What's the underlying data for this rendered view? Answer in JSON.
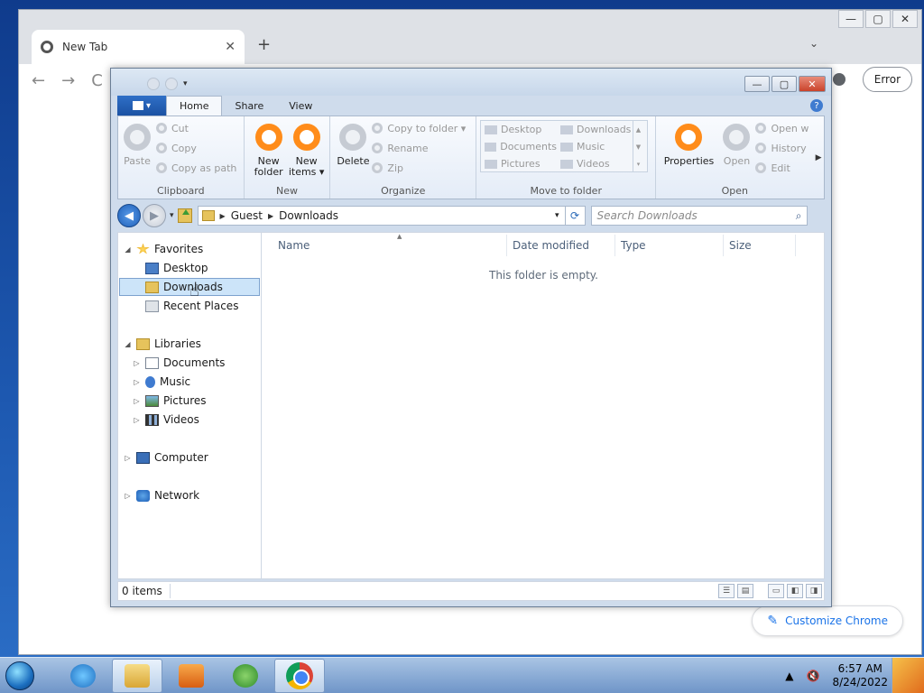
{
  "chrome": {
    "tab_title": "New Tab",
    "tab_close": "✕",
    "new_tab": "+",
    "tab_search": "⌄",
    "back": "←",
    "forward": "→",
    "reload": "C",
    "error_label": "Error",
    "customize_label": "Customize Chrome",
    "window_controls": {
      "minimize": "—",
      "maximize": "▢",
      "close": "✕"
    }
  },
  "explorer": {
    "qat_arrow": "▾",
    "window_controls": {
      "minimize": "—",
      "maximize": "▢",
      "close": "✕"
    },
    "file_menu_arrow": "▾",
    "tabs": [
      "Home",
      "Share",
      "View"
    ],
    "help": "?",
    "ribbon": {
      "clipboard": {
        "label": "Clipboard",
        "paste": "Paste",
        "cut": "Cut",
        "copy": "Copy",
        "copy_as_path": "Copy as path"
      },
      "new": {
        "label": "New",
        "new_folder": "New folder",
        "new_items": "New items ▾"
      },
      "organize": {
        "label": "Organize",
        "delete": "Delete",
        "copy_to_folder": "Copy to folder ▾",
        "rename": "Rename",
        "zip": "Zip"
      },
      "move_to_folder": {
        "label": "Move to folder",
        "items": [
          "Desktop",
          "Downloads",
          "Documents",
          "Music",
          "Pictures",
          "Videos"
        ]
      },
      "open": {
        "label": "Open",
        "properties": "Properties",
        "open": "Open",
        "open_with": "Open w",
        "history": "History",
        "edit": "Edit"
      }
    },
    "address": {
      "crumbs": [
        "Guest",
        "Downloads"
      ],
      "search_placeholder": "Search Downloads"
    },
    "nav": {
      "favorites": "Favorites",
      "desktop": "Desktop",
      "downloads": "Downloads",
      "recent_places": "Recent Places",
      "libraries": "Libraries",
      "documents": "Documents",
      "music": "Music",
      "pictures": "Pictures",
      "videos": "Videos",
      "computer": "Computer",
      "network": "Network"
    },
    "columns": [
      "Name",
      "Date modified",
      "Type",
      "Size"
    ],
    "empty_message": "This folder is empty.",
    "status_items": "0 items"
  },
  "taskbar": {
    "time": "6:57 AM",
    "date": "8/24/2022"
  }
}
